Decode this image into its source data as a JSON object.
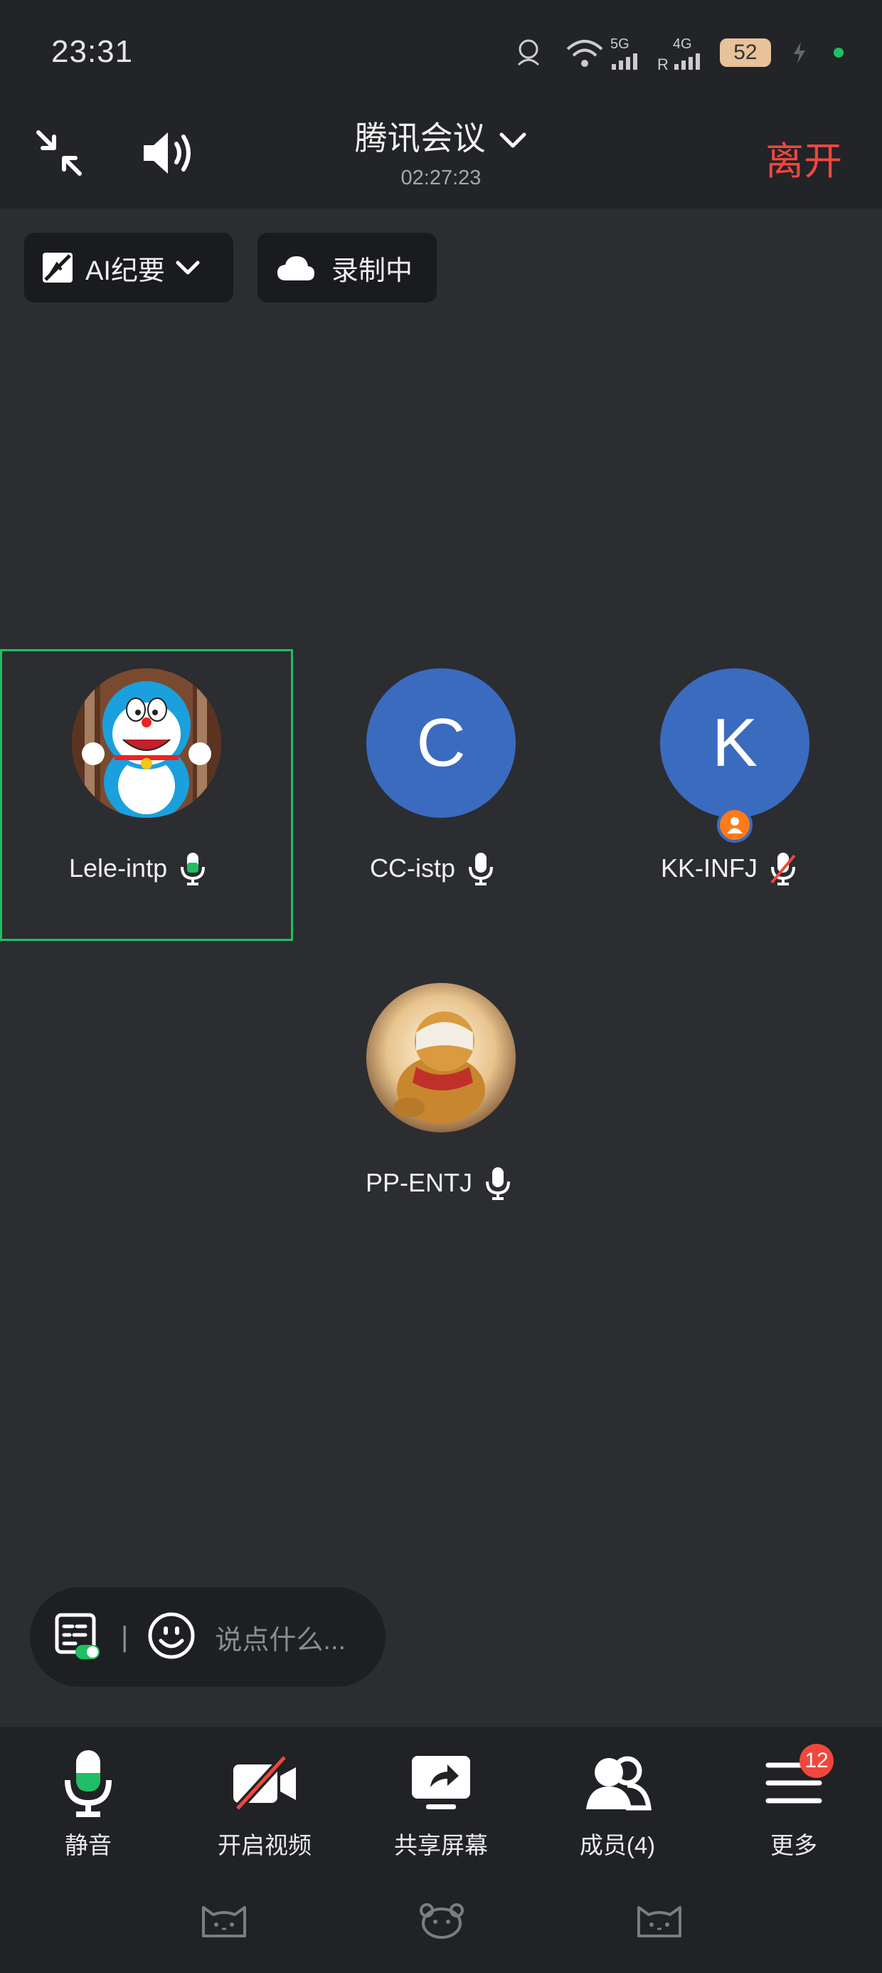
{
  "status_bar": {
    "time": "23:31",
    "net1": "5G",
    "net2": "4G",
    "roaming": "R",
    "battery": "52"
  },
  "header": {
    "title": "腾讯会议",
    "duration": "02:27:23",
    "leave_label": "离开"
  },
  "chips": {
    "ai_summary": "AI纪要",
    "recording": "录制中"
  },
  "participants": [
    {
      "name": "Lele-intp",
      "avatar": "doraemon-photo",
      "mic": "active"
    },
    {
      "name": "CC-istp",
      "avatar_letter": "C",
      "mic": "on"
    },
    {
      "name": "KK-INFJ",
      "avatar_letter": "K",
      "mic": "muted",
      "role": "host-icon"
    },
    {
      "name": "PP-ENTJ",
      "avatar": "bear-photo",
      "mic": "on"
    }
  ],
  "chat": {
    "placeholder": "说点什么...",
    "divider": "|"
  },
  "toolbar": {
    "mute": "静音",
    "video": "开启视频",
    "share": "共享屏幕",
    "members": "成员(4)",
    "more": "更多",
    "more_badge": "12"
  },
  "colors": {
    "background": "#2b2d31",
    "header": "#222427",
    "accent_green": "#1fbf63",
    "leave_red": "#f0473d",
    "avatar_blue": "#3b6bbf"
  }
}
